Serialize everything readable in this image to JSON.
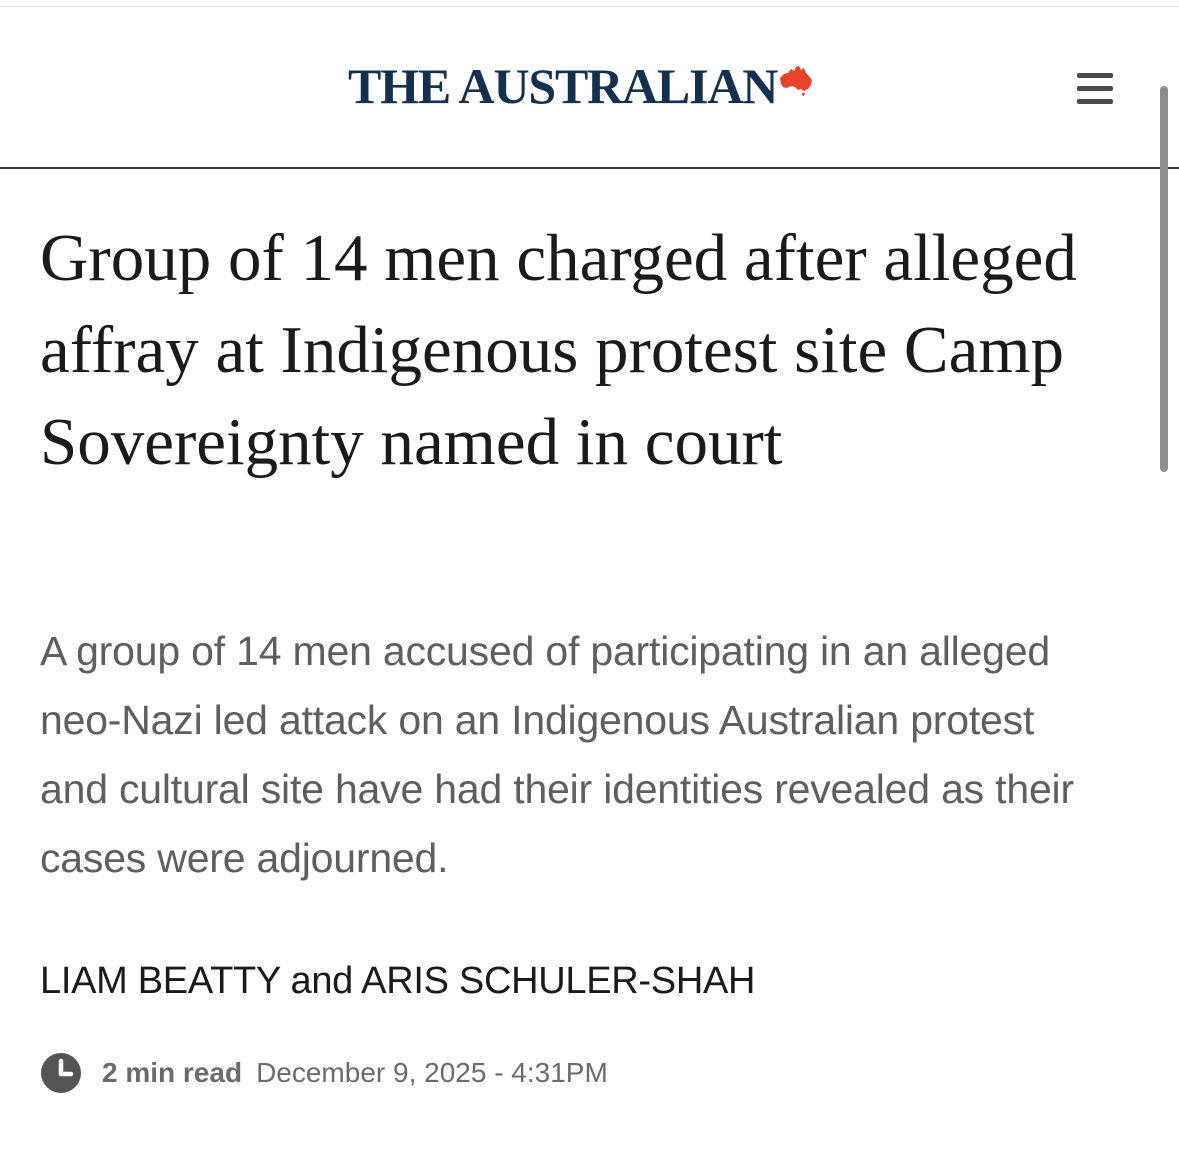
{
  "masthead": {
    "logo_text": "THE AUSTRALIAN",
    "logo_color": "#13314f",
    "map_color": "#e8442b",
    "menu_icon": "hamburger-menu-icon"
  },
  "article": {
    "headline": "Group of 14 men charged after alleged affray at Indigenous protest site Camp Sovereignty named in court",
    "standfirst": "A group of 14 men accused of participating in an alleged neo-Nazi led attack on an Indigenous Australian protest and cultural site have had their identities revealed as their cases were adjourned.",
    "byline": "LIAM BEATTY and ARIS SCHULER-SHAH",
    "read_time": "2 min read",
    "published": "December 9, 2025 - 4:31PM",
    "meta_icon": "clock-icon"
  }
}
